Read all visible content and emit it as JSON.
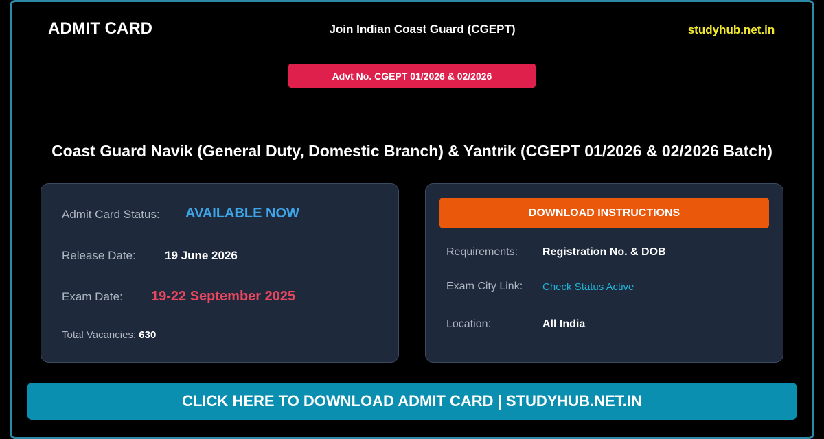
{
  "header": {
    "title": "ADMIT CARD",
    "subtitle": "Join Indian Coast Guard (CGEPT)",
    "site": "studyhub.net.in"
  },
  "advt_badge": "Advt No. CGEPT 01/2026 & 02/2026",
  "headline": "Coast Guard Navik (General Duty, Domestic Branch) & Yantrik (CGEPT 01/2026 & 02/2026 Batch)",
  "status_card": {
    "status_label": "Admit Card Status:",
    "status_value": "AVAILABLE NOW",
    "release_label": "Release Date:",
    "release_value": "19 June 2026",
    "exam_label": "Exam Date:",
    "exam_value": "19-22 September 2025",
    "vacancies_label": "Total Vacancies:",
    "vacancies_value": "630"
  },
  "instructions_card": {
    "button_label": "DOWNLOAD INSTRUCTIONS",
    "requirements_label": "Requirements:",
    "requirements_value": "Registration No. & DOB",
    "city_link_label": "Exam City Link:",
    "city_link_value": "Check Status Active",
    "location_label": "Location:",
    "location_value": "All India"
  },
  "cta_label": "CLICK HERE TO DOWNLOAD ADMIT CARD | STUDYHUB.NET.IN",
  "colors": {
    "status_available": "#3ea6e8",
    "exam_date": "#e8475f",
    "link": "#22b4d8",
    "instructions_button": "#ea580c",
    "cta": "#0b8fb1",
    "advt_badge": "#e0204c",
    "site_name": "#f2e92e"
  }
}
